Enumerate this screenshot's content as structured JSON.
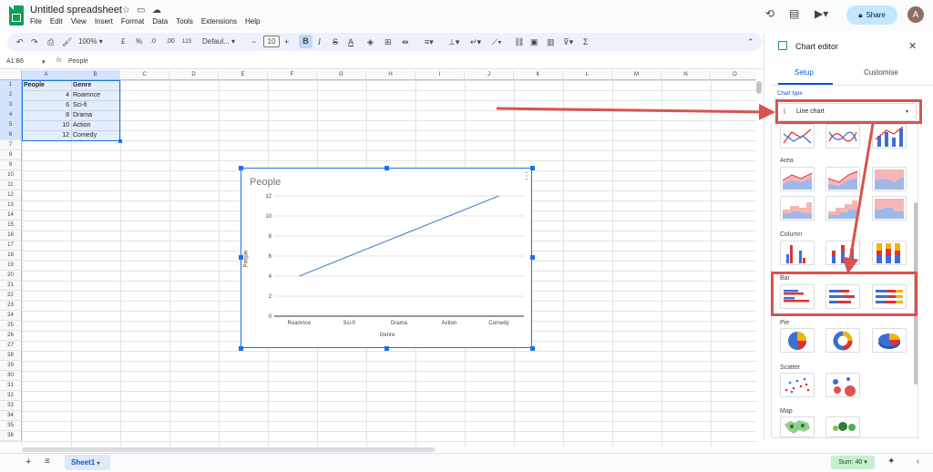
{
  "app": {
    "title": "Untitled spreadsheet",
    "menu": [
      "File",
      "Edit",
      "View",
      "Insert",
      "Format",
      "Data",
      "Tools",
      "Extensions",
      "Help"
    ],
    "share_label": "Share",
    "avatar_letter": "A"
  },
  "toolbar": {
    "zoom": "100%",
    "currency": "£",
    "percent": "%",
    "dec_decrease": ".0",
    "dec_increase": ".00",
    "number_format": "123",
    "font": "Defaul...",
    "font_size": "10",
    "bold": "B",
    "italic": "I",
    "strike": "S",
    "text_color": "A"
  },
  "formula_bar": {
    "cell_ref": "A1:B6",
    "fx": "fx",
    "content": "People"
  },
  "sheet": {
    "columns": [
      "A",
      "B",
      "C",
      "D",
      "E",
      "F",
      "G",
      "H",
      "I",
      "J",
      "K",
      "L",
      "M",
      "N",
      "O"
    ],
    "rows": [
      1,
      2,
      3,
      4,
      5,
      6,
      7,
      8,
      9,
      10,
      11,
      12,
      13,
      14,
      15,
      16,
      17,
      18,
      19,
      20,
      21,
      22,
      23,
      24,
      25,
      26,
      27,
      28,
      29,
      30,
      31,
      32,
      33,
      34,
      35,
      36
    ],
    "headers": [
      "People",
      "Genre"
    ],
    "data": [
      {
        "people": "4",
        "genre": "Roamnce"
      },
      {
        "people": "6",
        "genre": "Sci-fi"
      },
      {
        "people": "8",
        "genre": "Drama"
      },
      {
        "people": "10",
        "genre": "Action"
      },
      {
        "people": "12",
        "genre": "Comedy"
      }
    ]
  },
  "chart_data": {
    "type": "line",
    "title": "People",
    "xlabel": "Genre",
    "ylabel": "People",
    "categories": [
      "Roamnce",
      "Sci-fi",
      "Drama",
      "Action",
      "Comedy"
    ],
    "series": [
      {
        "name": "People",
        "values": [
          4,
          6,
          8,
          10,
          12
        ]
      }
    ],
    "yticks": [
      "0",
      "2",
      "4",
      "6",
      "8",
      "10",
      "12"
    ],
    "ylim": [
      0,
      12
    ],
    "grid": true,
    "line_color": "#4a86c6"
  },
  "editor": {
    "title": "Chart editor",
    "tabs": [
      "Setup",
      "Customise"
    ],
    "chart_type_label": "Chart type",
    "chart_type_value": "Line chart",
    "sections": [
      "Area",
      "Column",
      "Bar",
      "Pie",
      "Scatter",
      "Map"
    ]
  },
  "bottom": {
    "sheet_name": "Sheet1",
    "sum": "Sum: 40"
  },
  "colors": {
    "accent": "#1a73e8",
    "callout": "#d9534f",
    "selection": "#e8f0fe"
  }
}
